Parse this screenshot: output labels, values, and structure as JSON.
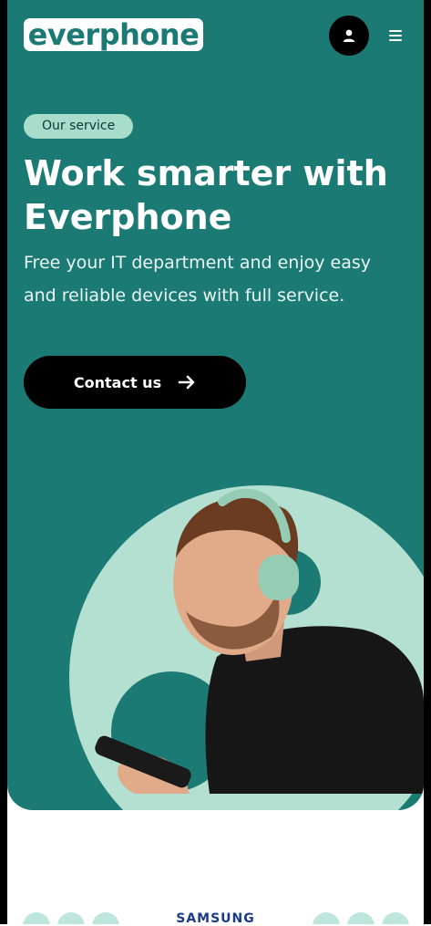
{
  "header": {
    "logo_text": "everphone",
    "account_icon": "user-icon",
    "menu_icon": "hamburger-menu-icon"
  },
  "hero": {
    "badge": "Our service",
    "headline": "Work smarter with Everphone",
    "subtext": "Free your IT department and enjoy easy and reliable devices with full service.",
    "cta_label": "Contact us",
    "cta_icon": "arrow-right-icon"
  },
  "partners": {
    "logo_text": "SAMSUNG"
  },
  "colors": {
    "hero_background": "#1c7a74",
    "accent_mint": "#a8dccb",
    "cta_background": "#000000"
  }
}
